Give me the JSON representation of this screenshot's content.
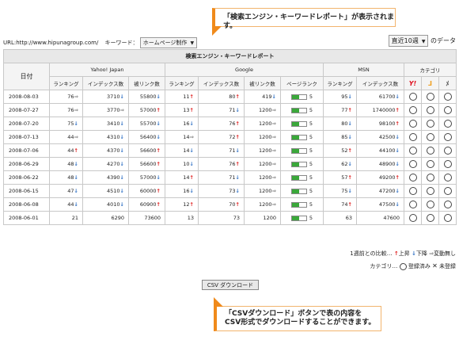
{
  "callouts": {
    "top": "「検索エンジン・キーワードレポート」が表示されます。",
    "bottom_line1": "「CSVダウンロード」ボタンで表の内容を",
    "bottom_line2": "CSV形式でダウンロードすることができます。"
  },
  "filter": {
    "url_label": "URL:http://www.hipunagroup.com/",
    "keyword_label": "キーワード：",
    "keyword_value": "ホームページ制作",
    "period_value": "直近10週",
    "period_suffix": "のデータ"
  },
  "report": {
    "title": "検索エンジン・キーワードレポート",
    "date_header": "日付",
    "groups": [
      "Yahoo! Japan",
      "Google",
      "MSN",
      "カテゴリ"
    ],
    "columns": [
      "ランキング",
      "インデックス数",
      "被リンク数",
      "ランキング",
      "インデックス数",
      "被リンク数",
      "ページランク",
      "ランキング",
      "インデックス数"
    ],
    "category_icons": [
      "Y!",
      "ᒧ",
      "ﾒ"
    ],
    "colors": {
      "up": "#e02020",
      "down": "#2e6fc4",
      "same": "#888888",
      "pagerank_bar": "#3aa83a"
    },
    "rows": [
      {
        "date": "2008-08-03",
        "cells": [
          [
            "76",
            "same"
          ],
          [
            "3710",
            "down"
          ],
          [
            "55800",
            "down"
          ],
          [
            "11",
            "up"
          ],
          [
            "80",
            "up"
          ],
          [
            "419",
            "down"
          ],
          [
            "5",
            "bar"
          ],
          [
            "95",
            "down"
          ],
          [
            "61700",
            "down"
          ]
        ]
      },
      {
        "date": "2008-07-27",
        "cells": [
          [
            "76",
            "same"
          ],
          [
            "3770",
            "same"
          ],
          [
            "57000",
            "up"
          ],
          [
            "13",
            "up"
          ],
          [
            "71",
            "down"
          ],
          [
            "1200",
            "same"
          ],
          [
            "5",
            "bar"
          ],
          [
            "77",
            "up"
          ],
          [
            "1740000",
            "up"
          ]
        ]
      },
      {
        "date": "2008-07-20",
        "cells": [
          [
            "75",
            "down"
          ],
          [
            "3410",
            "down"
          ],
          [
            "55700",
            "down"
          ],
          [
            "16",
            "down"
          ],
          [
            "76",
            "up"
          ],
          [
            "1200",
            "same"
          ],
          [
            "5",
            "bar"
          ],
          [
            "80",
            "down"
          ],
          [
            "98100",
            "up"
          ]
        ]
      },
      {
        "date": "2008-07-13",
        "cells": [
          [
            "44",
            "same"
          ],
          [
            "4310",
            "down"
          ],
          [
            "56400",
            "down"
          ],
          [
            "14",
            "same"
          ],
          [
            "72",
            "up"
          ],
          [
            "1200",
            "same"
          ],
          [
            "5",
            "bar"
          ],
          [
            "85",
            "down"
          ],
          [
            "42500",
            "down"
          ]
        ]
      },
      {
        "date": "2008-07-06",
        "cells": [
          [
            "44",
            "up"
          ],
          [
            "4370",
            "down"
          ],
          [
            "56600",
            "up"
          ],
          [
            "14",
            "down"
          ],
          [
            "71",
            "down"
          ],
          [
            "1200",
            "same"
          ],
          [
            "5",
            "bar"
          ],
          [
            "52",
            "up"
          ],
          [
            "44100",
            "down"
          ]
        ]
      },
      {
        "date": "2008-06-29",
        "cells": [
          [
            "48",
            "down"
          ],
          [
            "4270",
            "down"
          ],
          [
            "56600",
            "up"
          ],
          [
            "10",
            "down"
          ],
          [
            "76",
            "up"
          ],
          [
            "1200",
            "same"
          ],
          [
            "5",
            "bar"
          ],
          [
            "62",
            "down"
          ],
          [
            "48900",
            "down"
          ]
        ]
      },
      {
        "date": "2008-06-22",
        "cells": [
          [
            "48",
            "down"
          ],
          [
            "4390",
            "down"
          ],
          [
            "57000",
            "down"
          ],
          [
            "14",
            "up"
          ],
          [
            "71",
            "down"
          ],
          [
            "1200",
            "same"
          ],
          [
            "5",
            "bar"
          ],
          [
            "57",
            "up"
          ],
          [
            "49200",
            "up"
          ]
        ]
      },
      {
        "date": "2008-06-15",
        "cells": [
          [
            "47",
            "down"
          ],
          [
            "4510",
            "down"
          ],
          [
            "60000",
            "up"
          ],
          [
            "16",
            "down"
          ],
          [
            "73",
            "down"
          ],
          [
            "1200",
            "same"
          ],
          [
            "5",
            "bar"
          ],
          [
            "75",
            "down"
          ],
          [
            "47200",
            "down"
          ]
        ]
      },
      {
        "date": "2008-06-08",
        "cells": [
          [
            "44",
            "down"
          ],
          [
            "4010",
            "down"
          ],
          [
            "60900",
            "up"
          ],
          [
            "12",
            "up"
          ],
          [
            "70",
            "up"
          ],
          [
            "1200",
            "same"
          ],
          [
            "5",
            "bar"
          ],
          [
            "74",
            "up"
          ],
          [
            "47500",
            "down"
          ]
        ]
      },
      {
        "date": "2008-06-01",
        "cells": [
          [
            "21",
            "plain"
          ],
          [
            "6290",
            "plain"
          ],
          [
            "73600",
            "plain"
          ],
          [
            "13",
            "plain"
          ],
          [
            "73",
            "plain"
          ],
          [
            "1200",
            "plain"
          ],
          [
            "5",
            "bar"
          ],
          [
            "63",
            "plain"
          ],
          [
            "47600",
            "plain"
          ]
        ]
      }
    ]
  },
  "legend": {
    "compare_label": "1週前との比較…",
    "up_label": "上昇",
    "down_label": "下降",
    "same_label": "変動無し",
    "category_label": "カテゴリ…",
    "registered_label": "登録済み",
    "unregistered_label": "未登録"
  },
  "csv_button": "CSV ダウンロード"
}
